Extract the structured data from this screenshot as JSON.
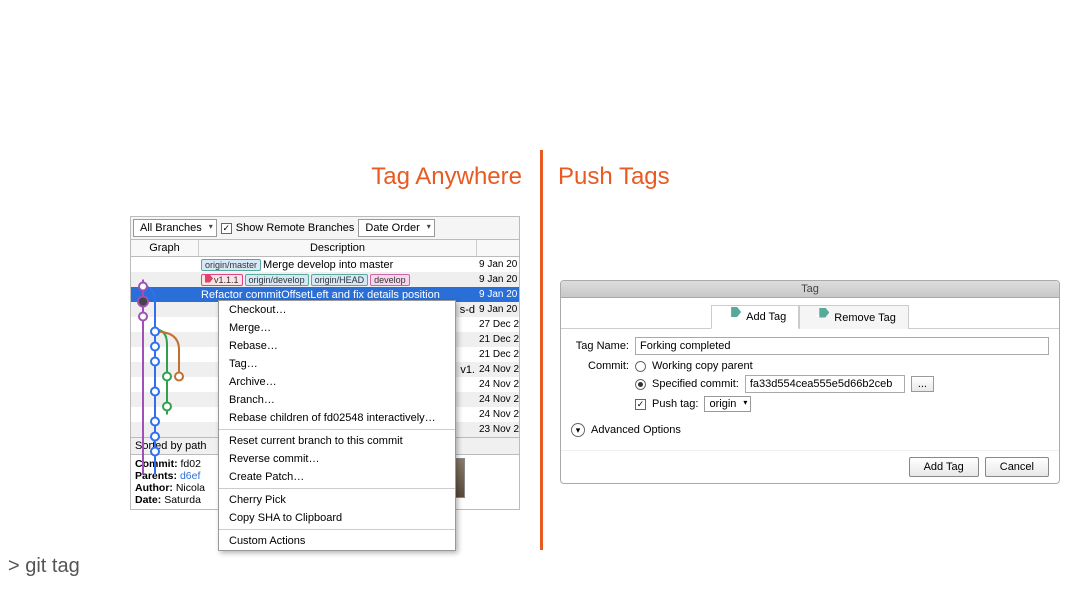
{
  "titles": {
    "left": "Tag Anywhere",
    "right": "Push Tags"
  },
  "toolbar": {
    "branches": "All Branches",
    "showRemote": "Show Remote Branches",
    "order": "Date Order"
  },
  "columns": {
    "graph": "Graph",
    "desc": "Description"
  },
  "badges": {
    "originMaster": "origin/master",
    "v111": "v1.1.1",
    "originDevelop": "origin/develop",
    "originHead": "origin/HEAD",
    "develop": "develop"
  },
  "rows": [
    {
      "msg": "Merge develop into master",
      "dt": "9 Jan 20"
    },
    {
      "msg": "",
      "dt": "9 Jan 20"
    },
    {
      "msg": "Refactor commitOffsetLeft and fix details position",
      "dt": "9 Jan 20"
    },
    {
      "msg": "s-d",
      "dt": "9 Jan 20"
    },
    {
      "msg": "",
      "dt": "27 Dec 2"
    },
    {
      "msg": "",
      "dt": "21 Dec 2"
    },
    {
      "msg": "",
      "dt": "21 Dec 2"
    },
    {
      "msg": "v1.",
      "dt": "24 Nov 2"
    },
    {
      "msg": "",
      "dt": "24 Nov 2"
    },
    {
      "msg": "",
      "dt": "24 Nov 2"
    },
    {
      "msg": "",
      "dt": "24 Nov 2"
    },
    {
      "msg": "",
      "dt": "23 Nov 2"
    }
  ],
  "ctx": [
    "Checkout…",
    "Merge…",
    "Rebase…",
    "Tag…",
    "Archive…",
    "Branch…",
    "Rebase children of fd02548 interactively…",
    "—",
    "Reset current branch to this commit",
    "Reverse commit…",
    "Create Patch…",
    "—",
    "Cherry Pick",
    "Copy SHA to Clipboard",
    "—",
    "Custom Actions"
  ],
  "sorted": "Sorted by path",
  "details": {
    "commit": "Commit:",
    "commitV": "fd02",
    "parents": "Parents:",
    "parentsV": "d6ef",
    "author": "Author:",
    "authorV": "Nicola",
    "date": "Date:",
    "dateV": "Saturda"
  },
  "dialog": {
    "title": "Tag",
    "tabs": {
      "add": "Add Tag",
      "remove": "Remove Tag"
    },
    "tagNameLabel": "Tag Name:",
    "tagNameVal": "Forking completed",
    "commitLabel": "Commit:",
    "optWorking": "Working copy parent",
    "optSpecified": "Specified commit:",
    "specifiedVal": "fa33d554cea555e5d66b2ceb",
    "browse": "...",
    "pushTag": "Push tag:",
    "pushTo": "origin",
    "advanced": "Advanced Options",
    "btnAdd": "Add Tag",
    "btnCancel": "Cancel"
  },
  "cmdline": "> git tag"
}
